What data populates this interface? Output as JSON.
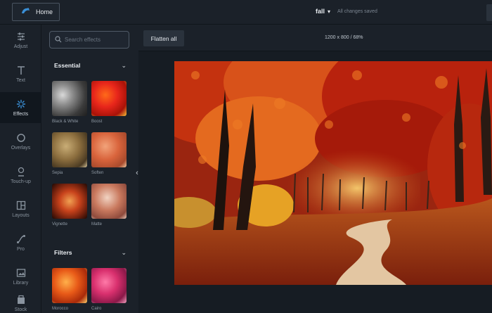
{
  "header": {
    "home_label": "Home",
    "project_name": "fall",
    "save_status": "All changes saved"
  },
  "rail": {
    "items": [
      {
        "label": "Adjust",
        "icon": "sliders-icon"
      },
      {
        "label": "Text",
        "icon": "text-icon"
      },
      {
        "label": "Effects",
        "icon": "sparkle-icon"
      },
      {
        "label": "Overlays",
        "icon": "circle-icon"
      },
      {
        "label": "Touch-up",
        "icon": "face-icon"
      },
      {
        "label": "Layouts",
        "icon": "grid-icon"
      },
      {
        "label": "Pro",
        "icon": "curve-icon"
      },
      {
        "label": "Library",
        "icon": "image-icon"
      },
      {
        "label": "Stock",
        "icon": "stock-icon"
      }
    ],
    "active": "Effects"
  },
  "effects_panel": {
    "search_placeholder": "Search effects",
    "sections": {
      "essential": {
        "title": "Essential",
        "items": [
          {
            "label": "Black & White"
          },
          {
            "label": "Boost"
          },
          {
            "label": "Sepia"
          },
          {
            "label": "Soften"
          },
          {
            "label": "Vignette"
          },
          {
            "label": "Matte"
          }
        ]
      },
      "filters": {
        "title": "Filters",
        "items": [
          {
            "label": "Morocco"
          },
          {
            "label": "Cairo"
          }
        ]
      }
    }
  },
  "canvas": {
    "flatten_label": "Flatten all",
    "dimensions": "1200 x 800 / 68%"
  },
  "colors": {
    "accent": "#3a8fd6",
    "background": "#1b2129",
    "canvas_bg": "#161c23"
  }
}
